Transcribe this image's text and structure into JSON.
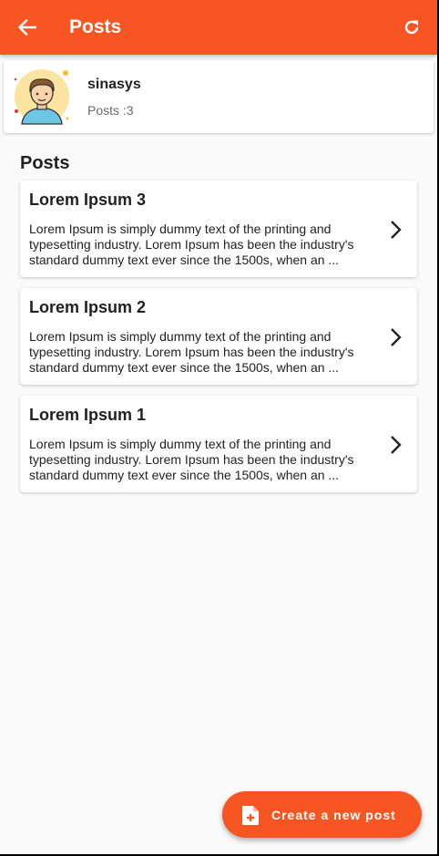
{
  "appbar": {
    "title": "Posts",
    "back_icon": "arrow-left-icon",
    "refresh_icon": "refresh-icon",
    "color": "#f75623"
  },
  "profile": {
    "username": "sinasys",
    "post_count_label": "Posts :3",
    "avatar_icon": "user-avatar"
  },
  "posts_section": {
    "title": "Posts"
  },
  "posts": [
    {
      "title": "Lorem Ipsum 3",
      "body": "Lorem Ipsum is simply dummy text of the printing and typesetting industry. Lorem Ipsum has been the industry's standard dummy text ever since the 1500s, when an ..."
    },
    {
      "title": "Lorem Ipsum 2",
      "body": "Lorem Ipsum is simply dummy text of the printing and typesetting industry. Lorem Ipsum has been the industry's standard dummy text ever since the 1500s, when an ..."
    },
    {
      "title": "Lorem Ipsum 1",
      "body": "Lorem Ipsum is simply dummy text of the printing and typesetting industry. Lorem Ipsum has been the industry's standard dummy text ever since the 1500s, when an ..."
    }
  ],
  "fab": {
    "label": "Create a new post",
    "icon": "add-document-icon"
  }
}
